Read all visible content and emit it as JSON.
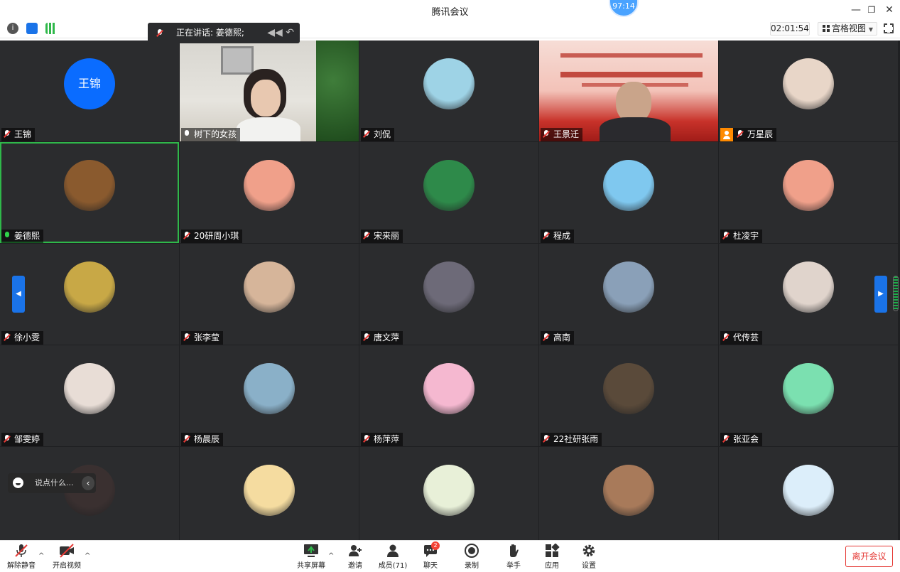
{
  "window": {
    "title": "腾讯会议",
    "network_badge": "97:14",
    "controls": [
      "—",
      "❐",
      "✕"
    ]
  },
  "infobar": {
    "timer": "02:01:54",
    "view_mode": "宫格视图"
  },
  "speaking": {
    "label": "正在讲话: 姜德熙;"
  },
  "tiles": [
    {
      "name": "王锦",
      "avatar_text": "王锦",
      "type": "text"
    },
    {
      "name": "树下的女孩",
      "type": "video",
      "mic": "live"
    },
    {
      "name": "刘侃",
      "type": "avatar",
      "color": "#9ed3e6"
    },
    {
      "name": "王景迁",
      "type": "video2"
    },
    {
      "name": "万星辰",
      "type": "avatar",
      "color": "#e8d6c8",
      "host": true
    },
    {
      "name": "姜德熙",
      "type": "avatar",
      "color": "#8a5a2e",
      "mic": "on",
      "active": true
    },
    {
      "name": "20研周小琪",
      "type": "avatar",
      "color": "#f0a08a"
    },
    {
      "name": "宋来丽",
      "type": "avatar",
      "color": "#2e8a4a"
    },
    {
      "name": "程成",
      "type": "avatar",
      "color": "#7fc8ef"
    },
    {
      "name": "杜凌宇",
      "type": "avatar",
      "color": "#f0a08a"
    },
    {
      "name": "徐小雯",
      "type": "avatar",
      "color": "#c8a846"
    },
    {
      "name": "张李莹",
      "type": "avatar",
      "color": "#d6b59a"
    },
    {
      "name": "唐文萍",
      "type": "avatar",
      "color": "#6d6a78"
    },
    {
      "name": "高南",
      "type": "avatar",
      "color": "#8aa0b8"
    },
    {
      "name": "代传芸",
      "type": "avatar",
      "color": "#e0d4cc"
    },
    {
      "name": "邹雯婷",
      "type": "avatar",
      "color": "#e8ddd6"
    },
    {
      "name": "杨晨辰",
      "type": "avatar",
      "color": "#8ab0c8"
    },
    {
      "name": "杨萍萍",
      "type": "avatar",
      "color": "#f5b8d0"
    },
    {
      "name": "22社研张雨",
      "type": "avatar",
      "color": "#5a4a3a"
    },
    {
      "name": "张亚会",
      "type": "avatar",
      "color": "#7be0b0"
    },
    {
      "name": "",
      "type": "avatar",
      "color": "#3a3030"
    },
    {
      "name": "",
      "type": "avatar",
      "color": "#f5dca0"
    },
    {
      "name": "",
      "type": "avatar",
      "color": "#e8f0d8"
    },
    {
      "name": "",
      "type": "avatar",
      "color": "#a87a5a"
    },
    {
      "name": "",
      "type": "avatar",
      "color": "#dceefa"
    }
  ],
  "chat_prompt": "说点什么...",
  "toolbar": {
    "unmute": "解除静音",
    "start_video": "开启视频",
    "share_screen": "共享屏幕",
    "invite": "邀请",
    "members": "成员(71)",
    "chat": "聊天",
    "chat_badge": "2",
    "record": "录制",
    "raise_hand": "举手",
    "apps": "应用",
    "settings": "设置",
    "leave": "离开会议"
  }
}
